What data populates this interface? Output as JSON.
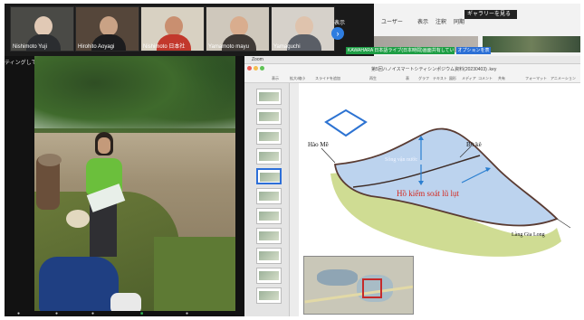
{
  "gallery": {
    "participants": [
      {
        "name": "Nishimoto Yuji"
      },
      {
        "name": "Hirohito Aoyagi"
      },
      {
        "name": "Nishimoto 日本社"
      },
      {
        "name": "Yamamoto mayu"
      },
      {
        "name": "Yamaguchi"
      }
    ],
    "next_page_icon": "chevron-right-icon",
    "view_label": "表示"
  },
  "zoom_top": {
    "gallery_button": "ギャラリーを見る",
    "menu_items": [
      "ユーザー",
      "表示",
      "注釈",
      "同期"
    ],
    "recording_notice": "KAWAHARA 日本語ライブ(日本時間)画面共有しています",
    "options_button": "オプションを表示"
  },
  "speaker": {
    "label": "ティングしています"
  },
  "share": {
    "window_title": "Zoom",
    "document_title": "第5回ハノイスマートシティシンポジウム資料(20230403) .key",
    "toolbar_items": [
      "表示",
      "拡大/縮小",
      "スライドを追加",
      "再生",
      "表",
      "グラフ",
      "テキスト",
      "図形",
      "メディア",
      "コメント",
      "共有",
      "フォーマット",
      "アニメーション",
      "書類"
    ],
    "slide": {
      "label_hao_me": "Hào Mê",
      "label_bo_ke": "Bờ kè",
      "label_ho": "Hồ kiểm soát lũ lụt",
      "label_lang": "Làng Gia Long",
      "label_water": "Sông vận nước"
    }
  },
  "colors": {
    "accent_blue": "#2d6fd8",
    "notice_green": "#1e9e45",
    "slide_red": "#d4281e",
    "lake_blue": "#bcd3ee",
    "grass_green": "#cfdc93"
  }
}
